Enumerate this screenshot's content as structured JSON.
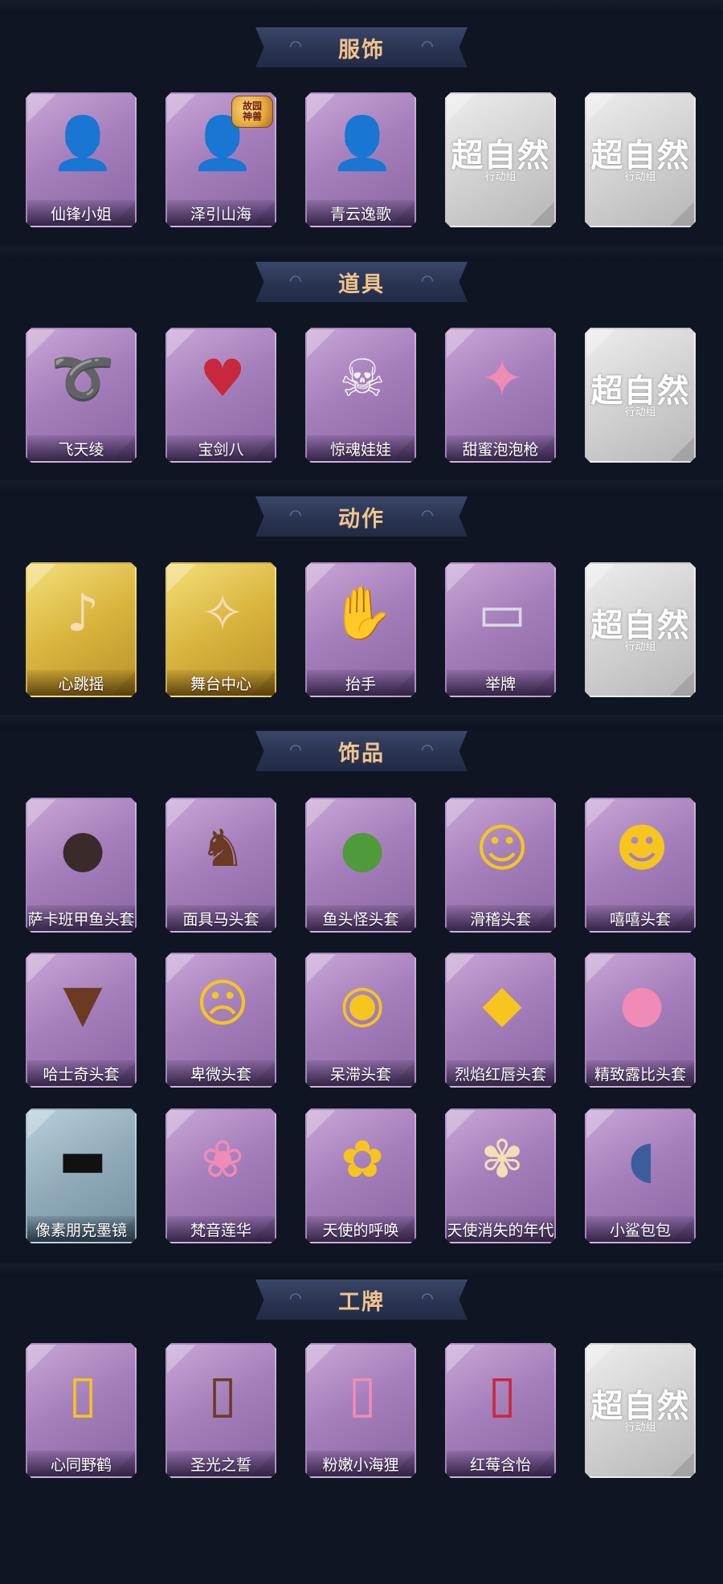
{
  "sections": [
    {
      "title": "服饰",
      "items": [
        {
          "label": "仙锋小姐",
          "style": "purple",
          "icon": "person-red-mask-icon",
          "glyph": "👤"
        },
        {
          "label": "泽引山海",
          "style": "purple",
          "icon": "person-silver-hair-icon",
          "glyph": "👤",
          "badge": [
            "故园",
            "神兽"
          ]
        },
        {
          "label": "青云逸歌",
          "style": "purple",
          "icon": "person-blue-robe-icon",
          "glyph": "👤"
        },
        {
          "label": "",
          "style": "grey",
          "locked": true
        },
        {
          "label": "",
          "style": "grey",
          "locked": true
        }
      ]
    },
    {
      "title": "道具",
      "items": [
        {
          "label": "飞天绫",
          "style": "purple",
          "icon": "ribbon-whip-icon",
          "glyph": "➰"
        },
        {
          "label": "宝剑八",
          "style": "purple",
          "icon": "heart-shield-icon",
          "glyph": "♥"
        },
        {
          "label": "惊魂娃娃",
          "style": "purple",
          "icon": "skull-doll-icon",
          "glyph": "☠"
        },
        {
          "label": "甜蜜泡泡枪",
          "style": "purple",
          "icon": "bubble-gun-icon",
          "glyph": "✦"
        },
        {
          "label": "",
          "style": "grey",
          "locked": true
        }
      ]
    },
    {
      "title": "动作",
      "items": [
        {
          "label": "心跳摇",
          "style": "gold",
          "icon": "dance-pose-icon",
          "glyph": "♪"
        },
        {
          "label": "舞台中心",
          "style": "gold",
          "icon": "stage-pose-icon",
          "glyph": "✧"
        },
        {
          "label": "抬手",
          "style": "purple",
          "icon": "raise-hand-icon",
          "glyph": "✋"
        },
        {
          "label": "举牌",
          "style": "purple",
          "icon": "hold-sign-icon",
          "glyph": "▭"
        },
        {
          "label": "",
          "style": "grey",
          "locked": true
        }
      ]
    },
    {
      "title": "饰品",
      "items": [
        {
          "label": "萨卡班甲鱼头套",
          "style": "purple",
          "icon": "fish-head-icon",
          "glyph": "●"
        },
        {
          "label": "面具马头套",
          "style": "purple",
          "icon": "horse-head-icon",
          "glyph": "♞"
        },
        {
          "label": "鱼头怪头套",
          "style": "purple",
          "icon": "fish-monster-head-icon",
          "glyph": "●"
        },
        {
          "label": "滑稽头套",
          "style": "purple",
          "icon": "funny-face-icon",
          "glyph": "☺"
        },
        {
          "label": "嘻嘻头套",
          "style": "purple",
          "icon": "grin-face-icon",
          "glyph": "☻"
        },
        {
          "label": "哈士奇头套",
          "style": "purple",
          "icon": "husky-head-icon",
          "glyph": "▼"
        },
        {
          "label": "卑微头套",
          "style": "purple",
          "icon": "humble-face-icon",
          "glyph": "☹"
        },
        {
          "label": "呆滞头套",
          "style": "purple",
          "icon": "dazed-face-icon",
          "glyph": "◉"
        },
        {
          "label": "烈焰红唇头套",
          "style": "purple",
          "icon": "red-lips-head-icon",
          "glyph": "◆"
        },
        {
          "label": "精致露比头套",
          "style": "purple",
          "icon": "ruby-head-icon",
          "glyph": "●"
        },
        {
          "label": "像素朋克墨镜",
          "style": "teal",
          "icon": "pixel-sunglasses-icon",
          "glyph": "▬"
        },
        {
          "label": "梵音莲华",
          "style": "purple",
          "icon": "lotus-spirit-icon",
          "glyph": "❀"
        },
        {
          "label": "天使的呼唤",
          "style": "purple",
          "icon": "angel-doll-icon",
          "glyph": "✿"
        },
        {
          "label": "天使消失的年代",
          "style": "purple",
          "icon": "angel-girl-icon",
          "glyph": "✾"
        },
        {
          "label": "小鲨包包",
          "style": "purple",
          "icon": "shark-bag-icon",
          "glyph": "◖"
        }
      ]
    },
    {
      "title": "工牌",
      "items": [
        {
          "label": "心同野鹤",
          "style": "purple",
          "icon": "gold-crane-card-icon",
          "glyph": "▯"
        },
        {
          "label": "圣光之誓",
          "style": "purple",
          "icon": "holy-light-card-icon",
          "glyph": "▯"
        },
        {
          "label": "粉嫩小海狸",
          "style": "purple",
          "icon": "pink-beaver-card-icon",
          "glyph": "▯"
        },
        {
          "label": "红莓含怡",
          "style": "purple",
          "icon": "strawberry-card-icon",
          "glyph": "▯"
        },
        {
          "label": "",
          "style": "grey",
          "locked": true
        }
      ]
    }
  ],
  "locked_placeholder": {
    "title": "超自然",
    "subtitle": "行动组"
  },
  "colors": {
    "background": "#0f1522",
    "header_text": "#f0c48c",
    "header_bg": "#2a3452",
    "card_purple": "#a57fbb",
    "card_gold": "#d9b43d",
    "card_grey": "#cfcfcf"
  }
}
